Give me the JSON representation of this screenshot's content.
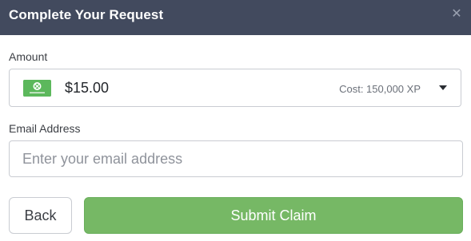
{
  "header": {
    "title": "Complete Your Request",
    "close_icon": "close-icon",
    "background": "#424a5e"
  },
  "amount": {
    "label": "Amount",
    "selected_value": "$15.00",
    "cost": "Cost: 150,000 XP",
    "card_icon": "xbox-gift-card-icon",
    "dropdown_icon": "caret-down-icon"
  },
  "email": {
    "label": "Email Address",
    "placeholder": "Enter your email address",
    "value": ""
  },
  "actions": {
    "back_label": "Back",
    "submit_label": "Submit Claim",
    "submit_color": "#76b865"
  }
}
